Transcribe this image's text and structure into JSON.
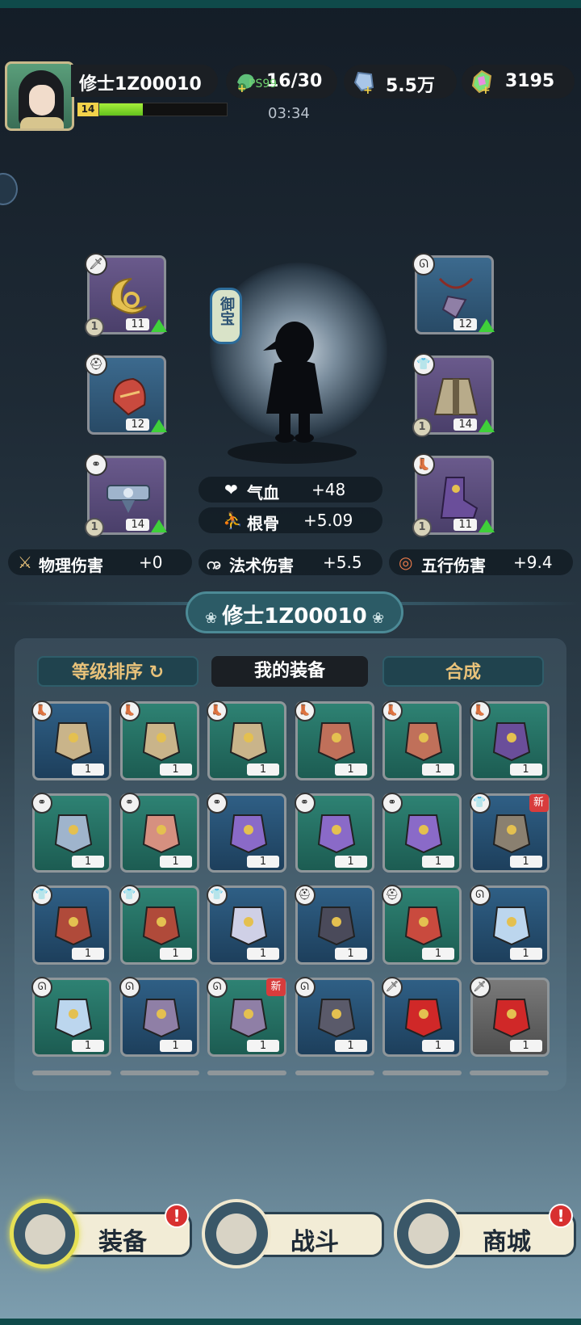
{
  "player": {
    "name": "修士1Z00010",
    "level": "14",
    "xp_progress_fraction": 0.34
  },
  "resources": [
    {
      "icon": "stamina-icon",
      "text": "16/30",
      "overlay": "PS99"
    },
    {
      "icon": "crystal-icon",
      "text": "5.5万"
    },
    {
      "icon": "gem-icon",
      "text": "3195"
    }
  ],
  "timer": "03:34",
  "treasure_label": "御宝",
  "equipped_left": [
    {
      "icon": "weapon-icon",
      "badge": "🗡",
      "tier": "1",
      "count": "11",
      "upgrade": true,
      "art": "gold-crescent"
    },
    {
      "icon": "helmet-icon",
      "badge": "⛑",
      "tier": "",
      "count": "12",
      "upgrade": true,
      "art": "red-helm"
    },
    {
      "icon": "belt-icon",
      "badge": "⚭",
      "tier": "1",
      "count": "14",
      "upgrade": true,
      "art": "silver-belt"
    }
  ],
  "equipped_right": [
    {
      "icon": "necklace-icon",
      "badge": "ᘏ",
      "tier": "",
      "count": "12",
      "upgrade": true,
      "art": "pendant"
    },
    {
      "icon": "armor-icon",
      "badge": "👕",
      "tier": "1",
      "count": "14",
      "upgrade": true,
      "art": "robe"
    },
    {
      "icon": "boots-icon",
      "badge": "👢",
      "tier": "1",
      "count": "11",
      "upgrade": true,
      "art": "purple-boot"
    }
  ],
  "center_stats": [
    {
      "icon": "heart-icon",
      "label": "气血",
      "value": "+48"
    },
    {
      "icon": "meditate-icon",
      "label": "根骨",
      "value": "+5.09"
    }
  ],
  "damage_stats": [
    {
      "icon": "sword-icon",
      "label": "物理伤害",
      "value": "+0"
    },
    {
      "icon": "spiral-icon",
      "label": "法术伤害",
      "value": "+5.5"
    },
    {
      "icon": "element-icon",
      "label": "五行伤害",
      "value": "+9.4"
    }
  ],
  "section_title": "修士1Z00010",
  "tabs": {
    "sort": "等级排序",
    "my_equipment": "我的装备",
    "synthesize": "合成"
  },
  "inventory": [
    [
      {
        "bg": "b",
        "badge": "👢",
        "count": "1",
        "art": "boot-tan",
        "new": ""
      },
      {
        "bg": "g1",
        "badge": "👢",
        "count": "1",
        "art": "boot-tan",
        "new": ""
      },
      {
        "bg": "g1",
        "badge": "👢",
        "count": "1",
        "art": "boot-tan",
        "new": ""
      },
      {
        "bg": "g1",
        "badge": "👢",
        "count": "1",
        "art": "boot-red",
        "new": ""
      },
      {
        "bg": "g1",
        "badge": "👢",
        "count": "1",
        "art": "boot-red",
        "new": ""
      },
      {
        "bg": "g1",
        "badge": "👢",
        "count": "1",
        "art": "boot-purple",
        "new": ""
      }
    ],
    [
      {
        "bg": "g1",
        "badge": "⚭",
        "count": "1",
        "art": "belt-silver",
        "new": ""
      },
      {
        "bg": "g1",
        "badge": "⚭",
        "count": "1",
        "art": "belt-red",
        "new": ""
      },
      {
        "bg": "b",
        "badge": "⚭",
        "count": "1",
        "art": "belt-purple",
        "new": ""
      },
      {
        "bg": "g1",
        "badge": "⚭",
        "count": "1",
        "art": "belt-purple",
        "new": ""
      },
      {
        "bg": "g1",
        "badge": "⚭",
        "count": "1",
        "art": "belt-purple",
        "new": ""
      },
      {
        "bg": "b",
        "badge": "👕",
        "count": "1",
        "art": "robe-dark",
        "new": "新"
      }
    ],
    [
      {
        "bg": "b",
        "badge": "👕",
        "count": "1",
        "art": "armor-red",
        "new": ""
      },
      {
        "bg": "g1",
        "badge": "👕",
        "count": "1",
        "art": "armor-red",
        "new": ""
      },
      {
        "bg": "b",
        "badge": "👕",
        "count": "1",
        "art": "robe-white",
        "new": ""
      },
      {
        "bg": "b",
        "badge": "⛑",
        "count": "1",
        "art": "helm-gold",
        "new": ""
      },
      {
        "bg": "g1",
        "badge": "⛑",
        "count": "1",
        "art": "helm-red",
        "new": ""
      },
      {
        "bg": "b",
        "badge": "ᘏ",
        "count": "1",
        "art": "pendant-blue",
        "new": ""
      }
    ],
    [
      {
        "bg": "g1",
        "badge": "ᘏ",
        "count": "1",
        "art": "pendant-blue",
        "new": ""
      },
      {
        "bg": "b",
        "badge": "ᘏ",
        "count": "1",
        "art": "pendant-purple",
        "new": ""
      },
      {
        "bg": "g1",
        "badge": "ᘏ",
        "count": "1",
        "art": "pendant-purple",
        "new": "新"
      },
      {
        "bg": "b",
        "badge": "ᘏ",
        "count": "1",
        "art": "pendant-dark",
        "new": ""
      },
      {
        "bg": "b",
        "badge": "🗡",
        "count": "1",
        "art": "ribbon-red",
        "new": ""
      },
      {
        "bg": "g",
        "badge": "🗡",
        "count": "1",
        "art": "ribbon-red",
        "new": ""
      }
    ]
  ],
  "bottom_nav": [
    {
      "label": "装备",
      "icon": "equipment-icon",
      "alert": "!",
      "active": true
    },
    {
      "label": "战斗",
      "icon": "battle-icon",
      "alert": "",
      "active": false
    },
    {
      "label": "商城",
      "icon": "shop-icon",
      "alert": "!",
      "active": false
    }
  ],
  "colors": {
    "accent_gold": "#e8c27a",
    "xp_green": "#63c11e",
    "alert_red": "#d83030",
    "teal": "#2c5b66"
  }
}
